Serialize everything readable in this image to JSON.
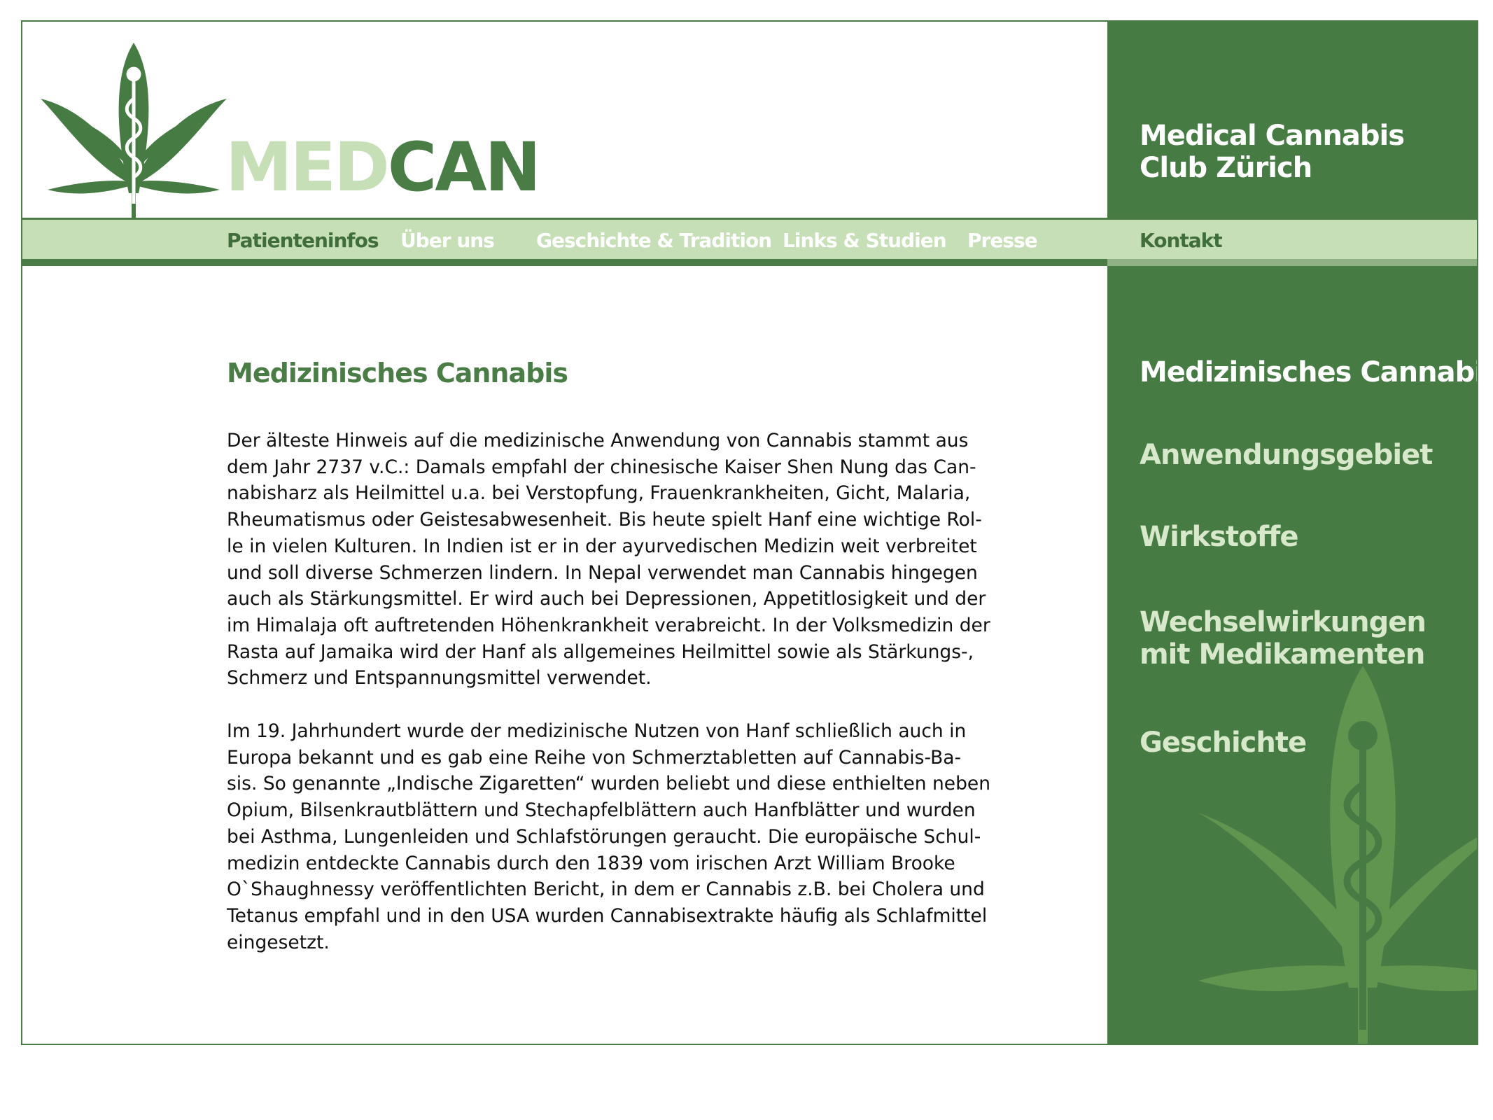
{
  "brand": {
    "logo_med": "MED",
    "logo_can": "CAN",
    "club_line1": "Medical Cannabis",
    "club_line2": "Club Zürich"
  },
  "nav": {
    "items": [
      {
        "label": "Patienteninfos",
        "active": true
      },
      {
        "label": "Über uns",
        "active": false
      },
      {
        "label": "Geschichte & Tradition",
        "active": false
      },
      {
        "label": "Links & Studien",
        "active": false
      },
      {
        "label": "Presse",
        "active": false
      },
      {
        "label": "Kontakt",
        "active": true
      }
    ]
  },
  "main": {
    "title": "Medizinisches Cannabis",
    "paragraph1_lines": [
      "Der älteste Hinweis auf die medizinische Anwendung von Cannabis stammt aus",
      "dem Jahr 2737 v.C.: Damals empfahl der chinesische Kaiser Shen Nung das Can-",
      "nabisharz als Heilmittel u.a. bei Verstopfung, Frauenkrankheiten, Gicht, Malaria,",
      "Rheumatismus oder Geistesabwesenheit. Bis heute spielt Hanf eine wichtige Rol-",
      "le in vielen Kulturen. In Indien ist er in der ayurvedischen Medizin weit verbreitet",
      "und soll diverse Schmerzen lindern. In Nepal verwendet man Cannabis hingegen",
      "auch als Stärkungsmittel. Er wird auch bei Depressionen, Appetitlosigkeit und der",
      "im Himalaja oft auftretenden Höhenkrankheit verabreicht. In der Volksmedizin der",
      "Rasta auf Jamaika wird der Hanf als allgemeines Heilmittel sowie als Stärkungs-,",
      "Schmerz und Entspannungsmittel verwendet."
    ],
    "paragraph2_lines": [
      "Im 19. Jahrhundert wurde der medizinische Nutzen von Hanf schließlich auch in",
      "Europa bekannt und es gab eine Reihe von Schmerztabletten auf Cannabis-Ba-",
      "sis. So genannte „Indische Zigaretten“ wurden beliebt und diese enthielten neben",
      "Opium, Bilsenkrautblättern und Stechapfelblättern auch Hanfblätter und wurden",
      "bei Asthma, Lungenleiden und Schlafstörungen geraucht. Die europäische Schul-",
      "medizin entdeckte Cannabis durch den 1839 vom irischen Arzt William Brooke",
      "O`Shaughnessy veröffentlichten Bericht, in dem er Cannabis z.B. bei Cholera und",
      "Tetanus empfahl und in den USA wurden Cannabisextrakte häufig als Schlafmittel",
      "eingesetzt."
    ]
  },
  "sidebar": {
    "items": [
      {
        "line1": "Medizinisches Cannabis",
        "line2": "",
        "active": true
      },
      {
        "line1": "Anwendungsgebiet",
        "line2": "",
        "active": false
      },
      {
        "line1": "Wirkstoffe",
        "line2": "",
        "active": false
      },
      {
        "line1": "Wechselwirkungen",
        "line2": "mit Medikamenten",
        "active": false
      },
      {
        "line1": "Geschichte",
        "line2": "",
        "active": false
      }
    ]
  },
  "icons": {
    "logo": "cannabis-leaf-caduceus-icon",
    "watermark": "cannabis-leaf-caduceus-watermark-icon"
  },
  "colors": {
    "primary_green": "#477b44",
    "light_green": "#c6dfb7",
    "sidebar_inactive": "#d7e8cb"
  }
}
